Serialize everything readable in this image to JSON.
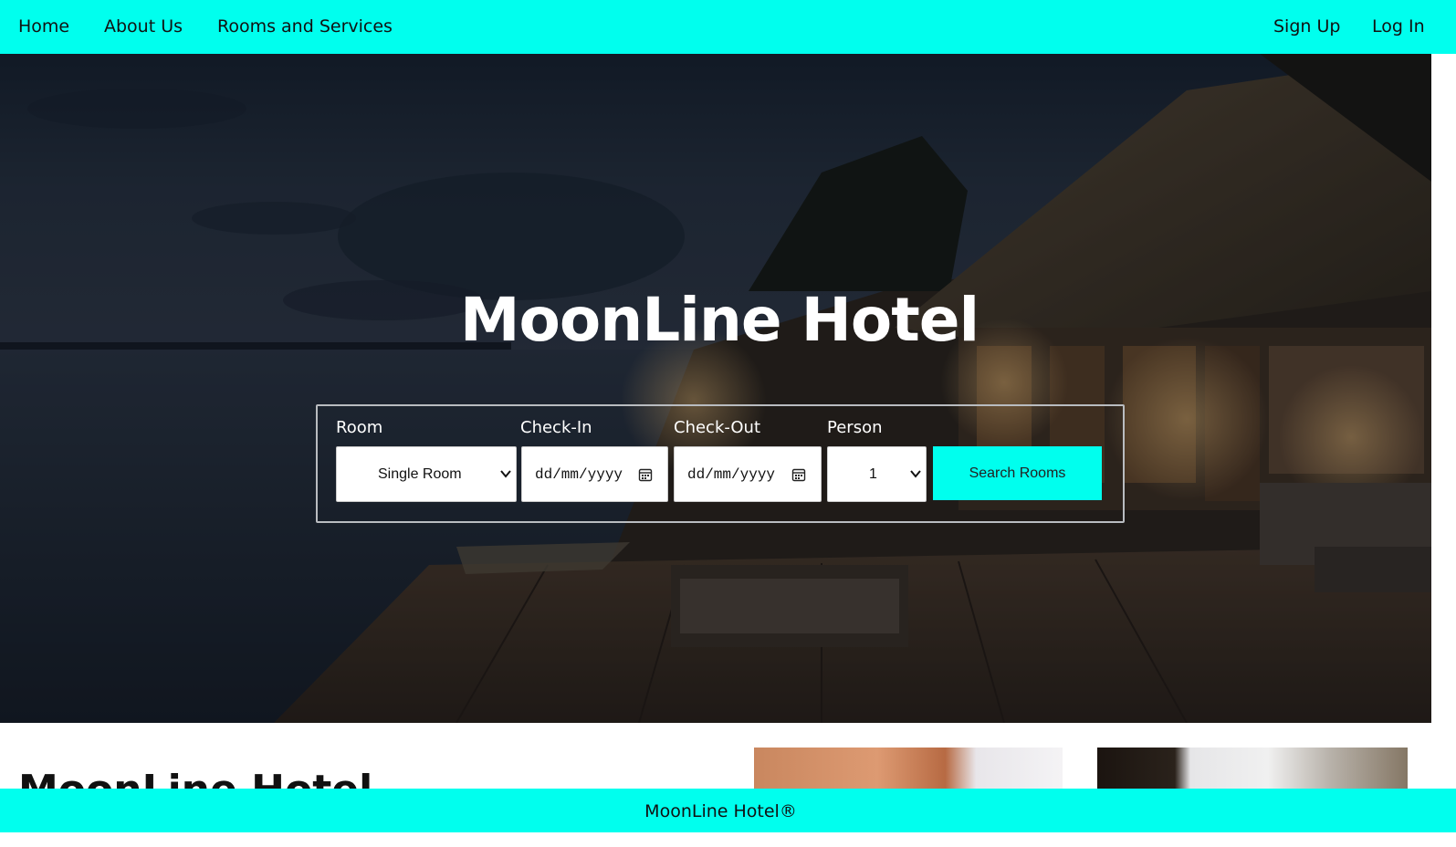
{
  "nav": {
    "home": "Home",
    "about": "About Us",
    "rooms": "Rooms and Services",
    "signup": "Sign Up",
    "login": "Log In"
  },
  "hero": {
    "title": "MoonLine Hotel"
  },
  "search": {
    "room_label": "Room",
    "room_value": "Single Room",
    "checkin_label": "Check-In",
    "checkin_placeholder": "dd/mm/yyyy",
    "checkout_label": "Check-Out",
    "checkout_placeholder": "dd/mm/yyyy",
    "person_label": "Person",
    "person_value": "1",
    "button_label": "Search Rooms"
  },
  "content": {
    "heading": "MoonLine Hotel"
  },
  "footer": {
    "text": "MoonLine Hotel®"
  },
  "colors": {
    "accent": "#00ffee"
  }
}
